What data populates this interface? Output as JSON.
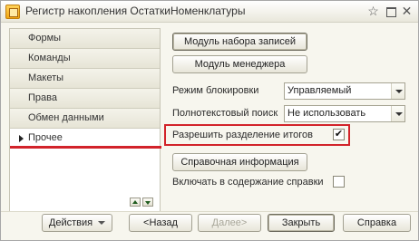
{
  "window": {
    "title": "Регистр накопления ОстаткиНоменклатуры",
    "fav_glyph": "☆",
    "close_glyph": "✕"
  },
  "sidebar": {
    "items": [
      {
        "label": "Формы",
        "active": false
      },
      {
        "label": "Команды",
        "active": false
      },
      {
        "label": "Макеты",
        "active": false
      },
      {
        "label": "Права",
        "active": false
      },
      {
        "label": "Обмен данными",
        "active": false
      },
      {
        "label": "Прочее",
        "active": true
      }
    ]
  },
  "main": {
    "record_set_module_button": "Модуль набора записей",
    "manager_module_button": "Модуль менеджера",
    "lock_mode": {
      "label": "Режим блокировки",
      "value": "Управляемый"
    },
    "fulltext_search": {
      "label": "Полнотекстовый поиск",
      "value": "Не использовать"
    },
    "split_totals": {
      "label": "Разрешить разделение итогов",
      "checked": true,
      "check_glyph": "✔"
    },
    "help_info_button": "Справочная информация",
    "include_in_help": {
      "label": "Включать в содержание справки",
      "checked": false
    }
  },
  "footer": {
    "actions_button": "Действия",
    "back_button": "<Назад",
    "next_button": "Далее>",
    "close_button": "Закрыть",
    "help_button": "Справка"
  },
  "colors": {
    "highlight": "#d2232a",
    "window_bg": "#f7f6ee"
  }
}
